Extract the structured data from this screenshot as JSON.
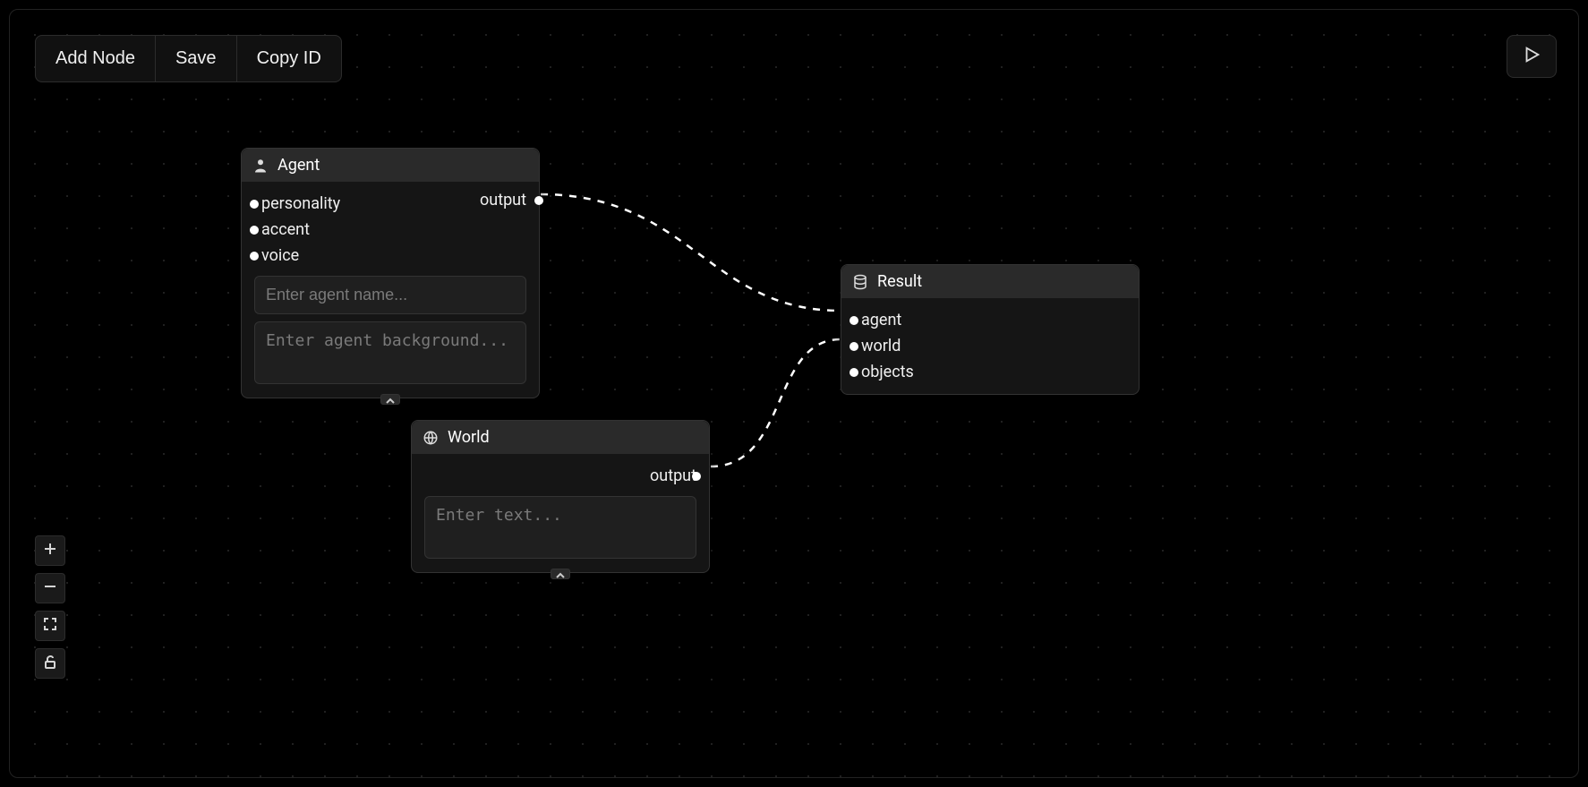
{
  "toolbar": {
    "add_node": "Add Node",
    "save": "Save",
    "copy_id": "Copy ID"
  },
  "nodes": {
    "agent": {
      "title": "Agent",
      "inputs": [
        "personality",
        "accent",
        "voice"
      ],
      "outputs": [
        "output"
      ],
      "name_placeholder": "Enter agent name...",
      "background_placeholder": "Enter agent background...",
      "name_value": "",
      "background_value": ""
    },
    "world": {
      "title": "World",
      "outputs": [
        "output"
      ],
      "text_placeholder": "Enter text...",
      "text_value": ""
    },
    "result": {
      "title": "Result",
      "inputs": [
        "agent",
        "world",
        "objects"
      ]
    }
  },
  "edges": [
    {
      "from": "agent.output",
      "to": "result.agent"
    },
    {
      "from": "world.output",
      "to": "result.world"
    }
  ],
  "colors": {
    "background": "#000000",
    "node_bg": "#151515",
    "node_header": "#2a2a2a",
    "border": "#333333",
    "text": "#f0f0f0"
  }
}
